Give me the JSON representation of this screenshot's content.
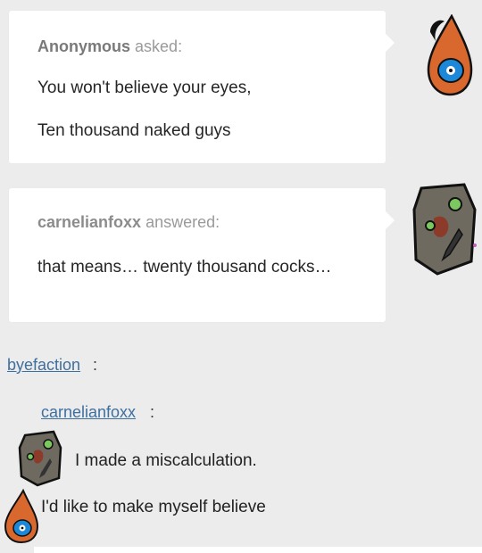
{
  "question": {
    "asker": "Anonymous",
    "verb": "asked:",
    "lines": [
      "You won't believe your eyes,",
      "Ten thousand naked guys"
    ]
  },
  "answer": {
    "answerer": "carnelianfoxx",
    "verb": "answered:",
    "text": "that means… twenty thousand cocks…"
  },
  "reblog": {
    "user": "byefaction",
    "nested_user": "carnelianfoxx",
    "colon": ":",
    "replies": [
      "I made a miscalculation.",
      "I'd like to make myself believe"
    ]
  },
  "colors": {
    "card": "#ffffff",
    "background": "#ececec",
    "link": "#3f6f9f",
    "drop_avatar": "#d9682f",
    "eye": "#1e88d8"
  },
  "icons": [
    "drop-eye-avatar-icon",
    "stone-face-avatar-icon"
  ]
}
